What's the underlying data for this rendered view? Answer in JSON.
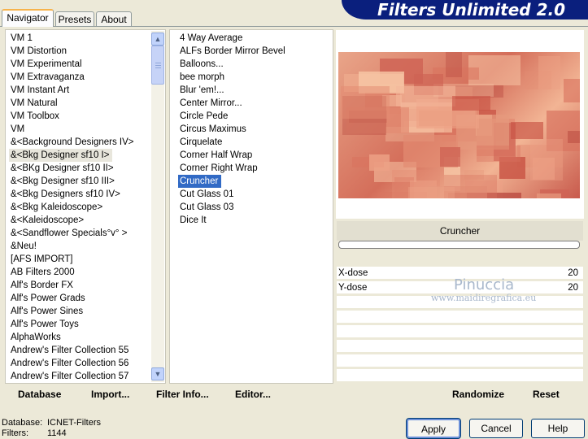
{
  "tabs": [
    {
      "label": "Navigator"
    },
    {
      "label": "Presets"
    },
    {
      "label": "About"
    }
  ],
  "title": "Filters Unlimited 2.0",
  "categories": [
    "VM 1",
    "VM Distortion",
    "VM Experimental",
    "VM Extravaganza",
    "VM Instant Art",
    "VM Natural",
    "VM Toolbox",
    "VM",
    "&<Background Designers IV>",
    "&<Bkg Designer sf10 I>",
    "&<BKg Designer sf10 II>",
    "&<Bkg Designer sf10 III>",
    "&<Bkg Designers sf10 IV>",
    "&<Bkg Kaleidoscope>",
    "&<Kaleidoscope>",
    "&<Sandflower Specials°v° >",
    "&Neu!",
    "[AFS IMPORT]",
    "AB Filters 2000",
    "Alf's Border FX",
    "Alf's Power Grads",
    "Alf's Power Sines",
    "Alf's Power Toys",
    "AlphaWorks",
    "Andrew's Filter Collection 55",
    "Andrew's Filter Collection 56",
    "Andrew's Filter Collection 57"
  ],
  "selected_category": "&<Bkg Designer sf10 I>",
  "filters": [
    "4 Way Average",
    "ALFs Border Mirror Bevel",
    "Balloons...",
    "bee morph",
    "Blur 'em!...",
    "Center Mirror...",
    "Circle Pede",
    "Circus Maximus",
    "Cirquelate",
    "Corner Half Wrap",
    "Corner Right Wrap",
    "Cruncher",
    "Cut Glass 01",
    "Cut Glass 03",
    "Dice It"
  ],
  "selected_filter": "Cruncher",
  "bottom_bar": {
    "database": "Database",
    "import": "Import...",
    "filter_info": "Filter Info...",
    "editor": "Editor...",
    "randomize": "Randomize",
    "reset": "Reset"
  },
  "preview_filter_name": "Cruncher",
  "params": [
    {
      "label": "X-dose",
      "value": "20"
    },
    {
      "label": "Y-dose",
      "value": "20"
    }
  ],
  "watermark": {
    "name": "Pinuccia",
    "url": "www.maidiregrafica.eu"
  },
  "status": {
    "database_label": "Database:",
    "database_value": "ICNET-Filters",
    "filters_label": "Filters:",
    "filters_value": "1144"
  },
  "dialog_buttons": {
    "apply": "Apply",
    "cancel": "Cancel",
    "help": "Help"
  },
  "colors": {
    "banner": "#0a1f7d",
    "selection": "#316ac5",
    "tab_accent": "#f7b34b"
  }
}
